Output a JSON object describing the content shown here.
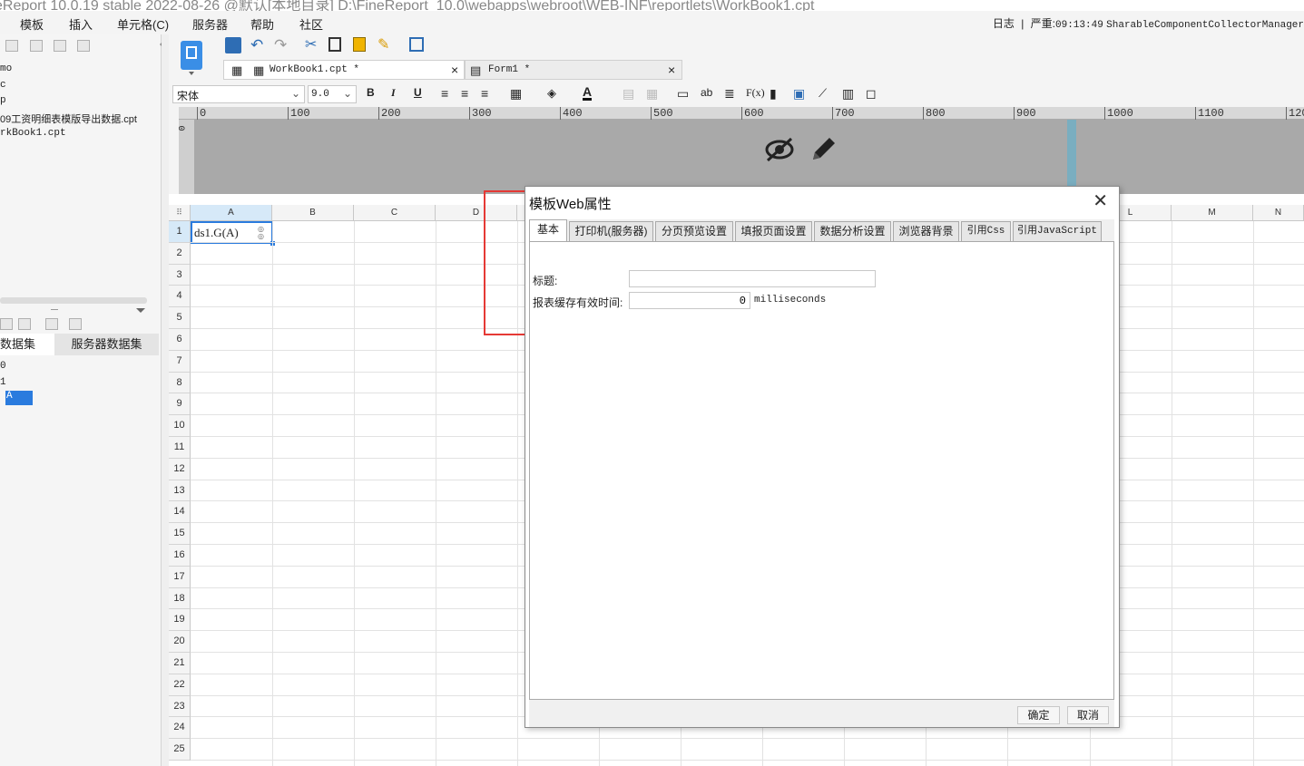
{
  "titlebar": {
    "text": "eReport 10.0.19 stable 2022-08-26 @默认[本地目录]    D:\\FineReport_10.0\\webapps\\webroot\\WEB-INF\\reportlets\\WorkBook1.cpt"
  },
  "menu": {
    "items": [
      "模板",
      "插入",
      "单元格(C)",
      "服务器",
      "帮助",
      "社区"
    ]
  },
  "logbar": {
    "log": "日志",
    "sep": "|",
    "severity": "严重:",
    "time": "09:13:49",
    "message": "SharableComponentCollectorManager"
  },
  "leftpanel": {
    "tree": [
      "mo",
      "c",
      "p",
      "09工资明细表模版导出数据.cpt",
      "rkBook1.cpt"
    ],
    "tabs": {
      "template_ds": "数据集",
      "server_ds": "服务器数据集"
    },
    "ds_items": [
      "0",
      "1",
      "A"
    ]
  },
  "doc_tabs": [
    {
      "label": "WorkBook1.cpt *",
      "close": "×"
    },
    {
      "label": "Form1 *",
      "close": "×"
    }
  ],
  "format_bar": {
    "font": "宋体",
    "size": "9.0",
    "bold": "B",
    "italic": "I",
    "underline": "U",
    "text_tool": "ab",
    "formula": "F(x)"
  },
  "ruler": {
    "ticks": [
      "0",
      "100",
      "200",
      "300",
      "400",
      "500",
      "600",
      "700",
      "800",
      "900",
      "1000",
      "1100",
      "120"
    ],
    "vtick": "0"
  },
  "grid": {
    "columns": [
      "A",
      "B",
      "C",
      "D",
      "L",
      "M",
      "N"
    ],
    "rows": [
      "1",
      "2",
      "3",
      "4",
      "5",
      "6",
      "7",
      "8",
      "9",
      "10",
      "11",
      "12",
      "13",
      "14",
      "15",
      "16",
      "17",
      "18",
      "19",
      "20",
      "21",
      "22",
      "23",
      "24",
      "25"
    ],
    "cell_a1": "ds1.G(A)"
  },
  "dialog": {
    "title": "模板Web属性",
    "close": "✕",
    "tabs": [
      "基本",
      "打印机(服务器)",
      "分页预览设置",
      "填报页面设置",
      "数据分析设置",
      "浏览器背景",
      "引用Css",
      "引用JavaScript"
    ],
    "active_tab": "基本",
    "fields": {
      "title_label": "标题:",
      "title_value": "",
      "cache_label": "报表缓存有效时间:",
      "cache_value": "0",
      "cache_unit": "milliseconds"
    },
    "ok": "确定",
    "cancel": "取消"
  },
  "highlight": {
    "color": "#e53935"
  }
}
